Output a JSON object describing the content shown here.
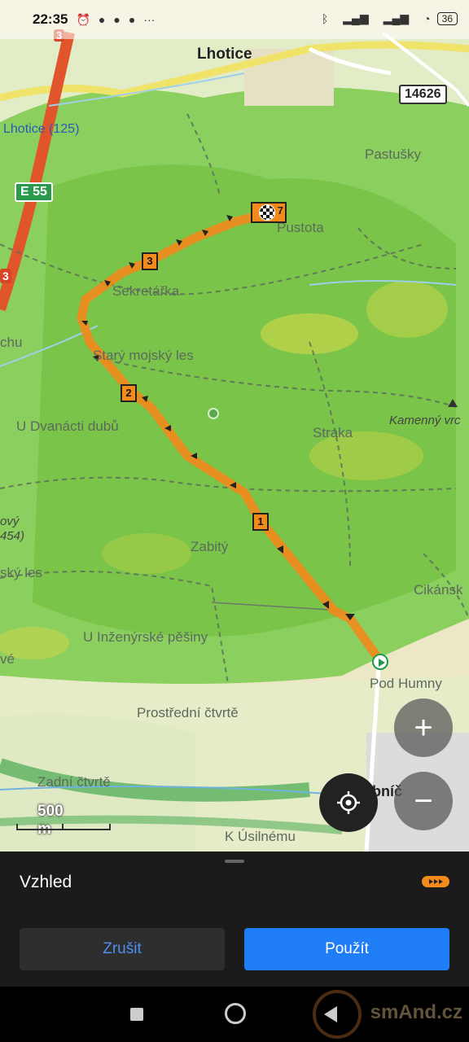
{
  "status_bar": {
    "time": "22:35",
    "icons": [
      "alarm-icon",
      "app-icon",
      "app-icon",
      "app-icon",
      "more-icon",
      "bluetooth-icon",
      "signal-icon",
      "signal-icon",
      "wifi-icon"
    ],
    "more": "···",
    "battery": "36"
  },
  "map": {
    "town": "Lhotice",
    "road_number": "14626",
    "road_e": "E 55",
    "road_3_top": "3",
    "road_3_left": "3",
    "places": {
      "lhotice_125": "Lhotice (125)",
      "pastusky": "Pastušky",
      "pustota": "Pustota",
      "sekretarka": "Sekretářka",
      "chu": "chu",
      "stary_mojsky_les": "Starý mojský les",
      "kamenny_vrch": "Kamenný vrc",
      "u_dvanacti_dubu": "U Dvanácti dubů",
      "straka": "Straka",
      "ovy": "ový",
      "n454": "454)",
      "zabity": "Zabitý",
      "sky_les": "ský les",
      "cikansk": "Cikánsk",
      "u_inzenyrske_pesiny": "U Inženýrské pěšiny",
      "ve": "vé",
      "pod_humny": "Pod Humny",
      "prostredni_ctvrte": "Prostřední čtvrtě",
      "zadni_ctvrte": "Zadní čtvrtě",
      "ibnic": "ibníč",
      "k_usilnemu": "K Úsilnému"
    },
    "waypoints": [
      "1",
      "2",
      "3"
    ],
    "finish_number": "7",
    "scale_label": "500 m",
    "controls": {
      "zoom_in": "+",
      "zoom_out": "−"
    },
    "colors": {
      "route": "#f28a1c",
      "forest": "#7ac943",
      "start": "#1e9c4c"
    }
  },
  "sheet": {
    "title": "Vzhled",
    "cancel_label": "Zrušit",
    "apply_label": "Použít"
  },
  "watermark": "smAnd.cz"
}
